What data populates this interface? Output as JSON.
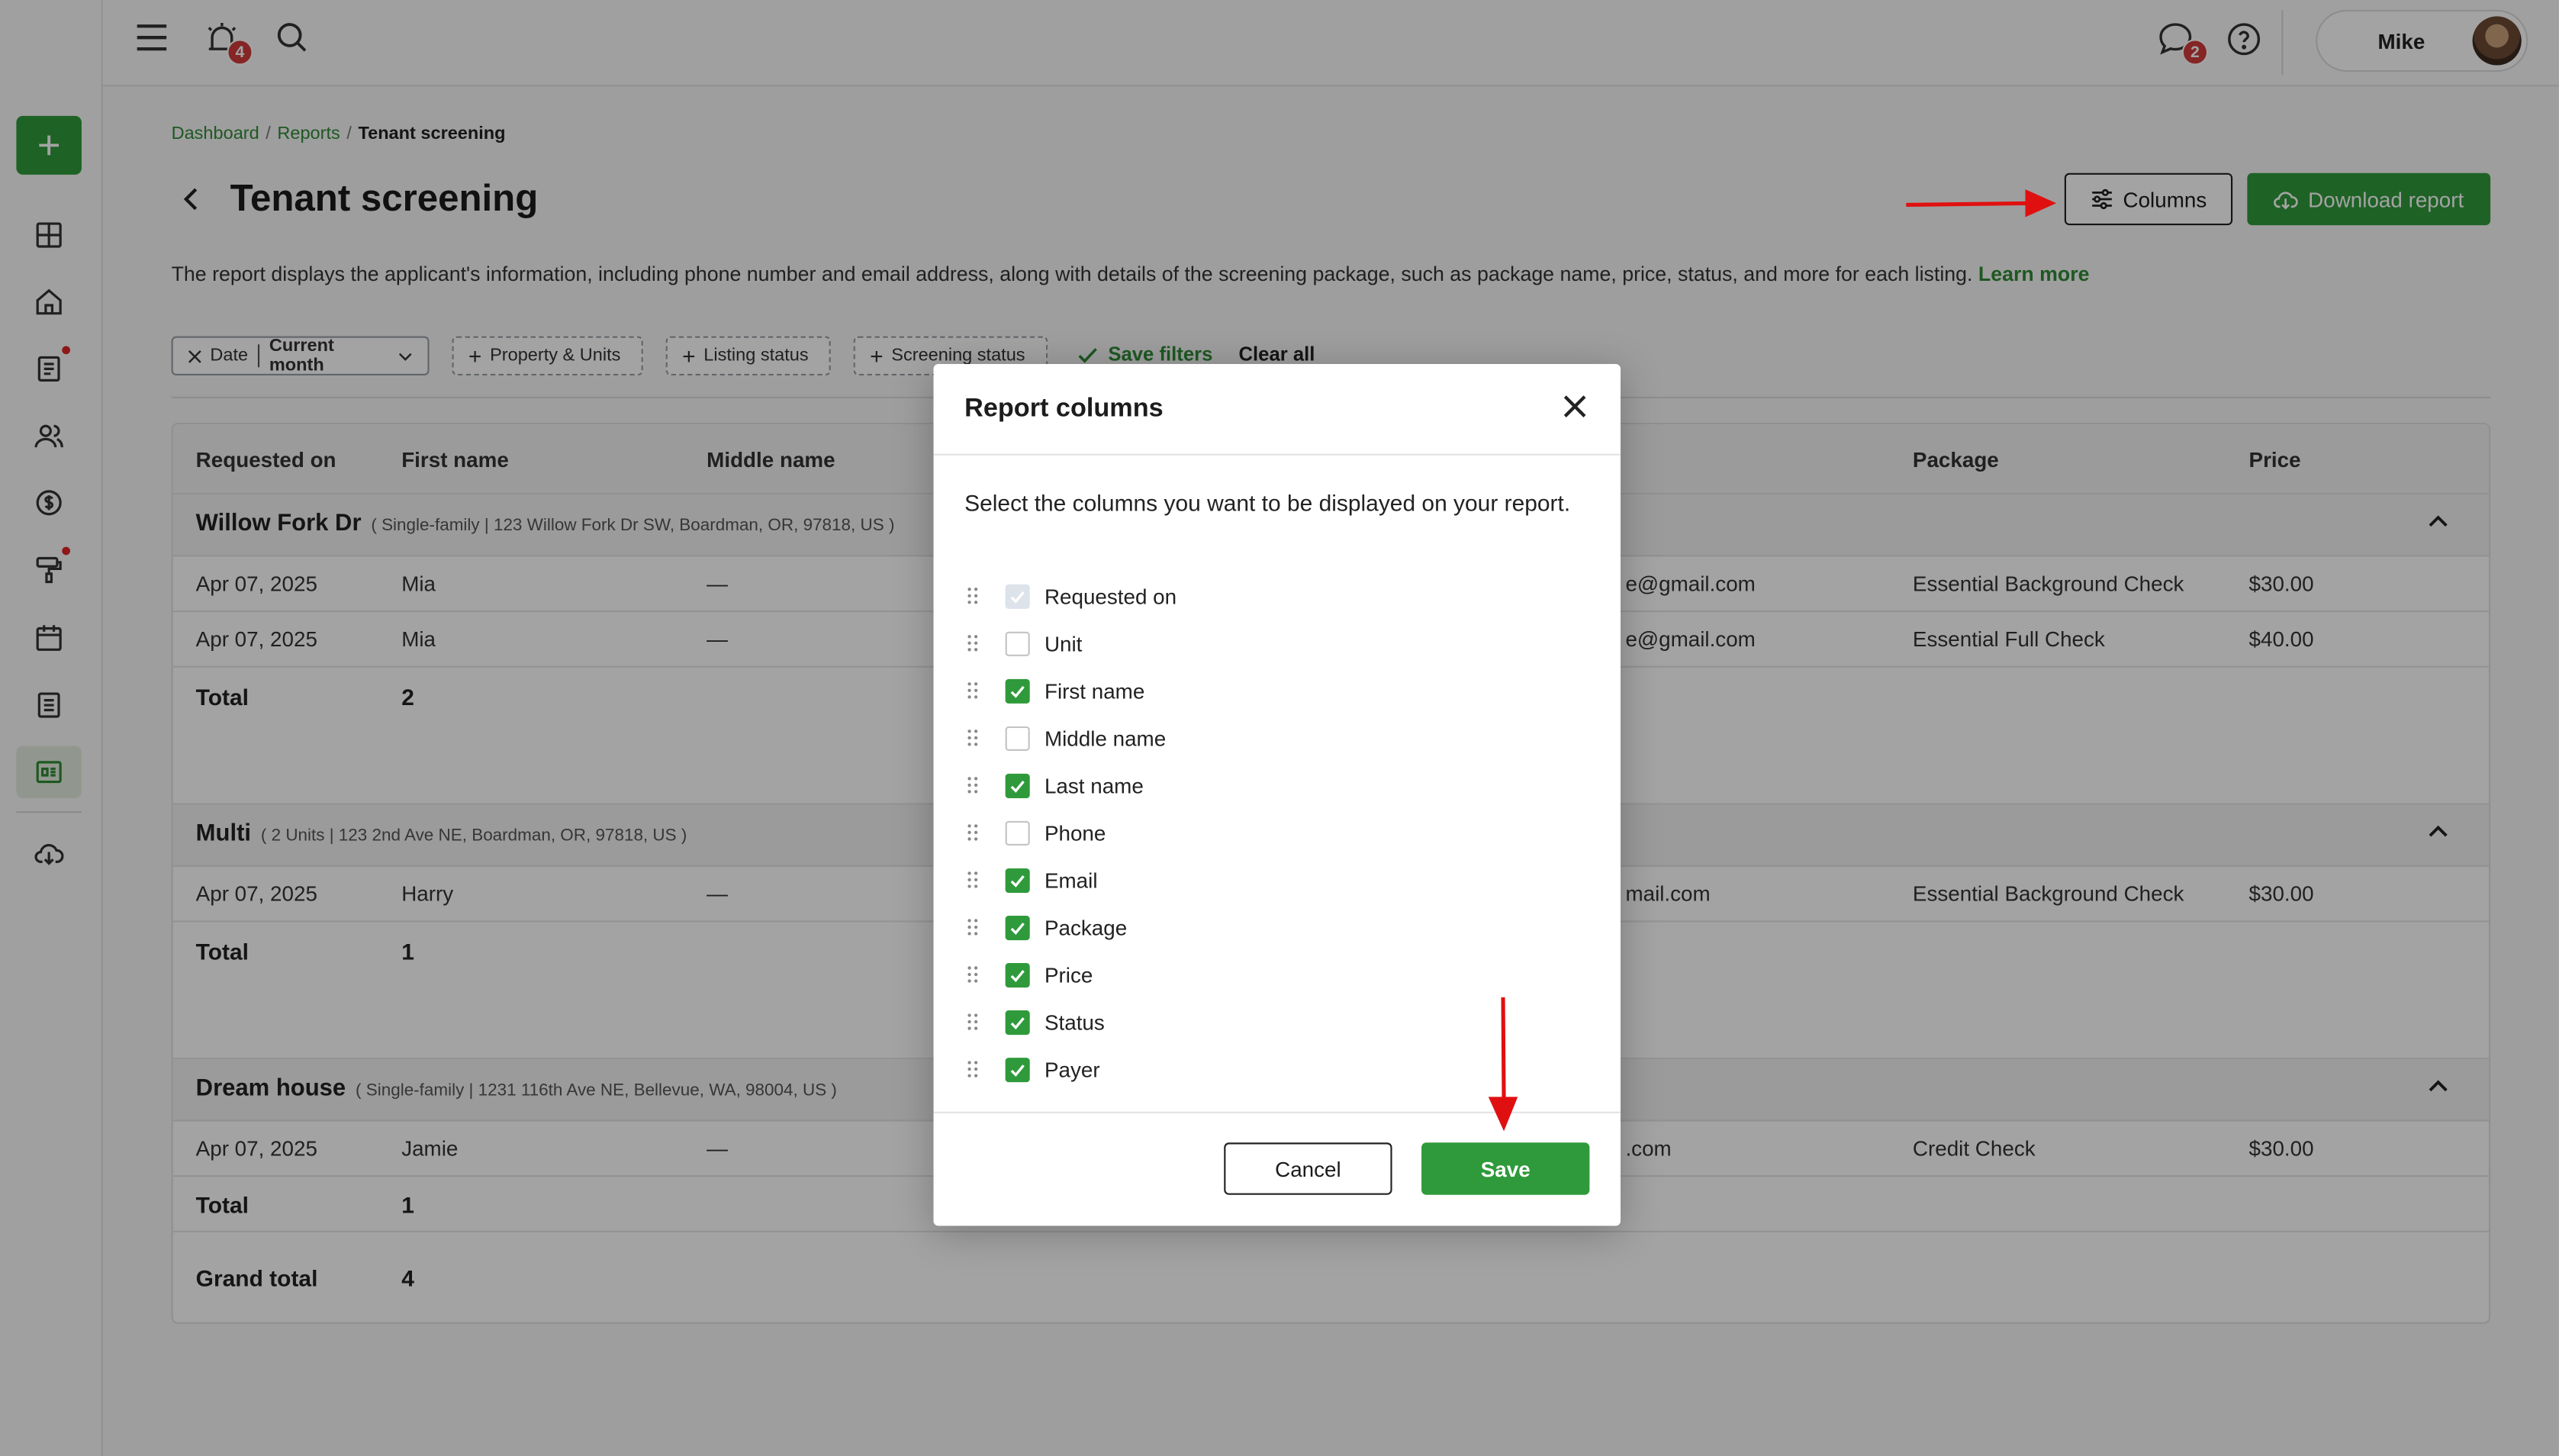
{
  "topbar": {
    "notifications_count": "4",
    "messages_count": "2",
    "user_name": "Mike"
  },
  "breadcrumb": {
    "items": [
      "Dashboard",
      "Reports"
    ],
    "current": "Tenant screening",
    "separator": "/"
  },
  "page": {
    "title": "Tenant screening",
    "columns_button": "Columns",
    "download_button": "Download report",
    "description": "The report displays the applicant's information, including phone number and email address, along with details of the screening package, such as package name, price, status, and more for each listing.",
    "learn_more": "Learn more"
  },
  "filters": {
    "date_label": "Date",
    "date_value": "Current month",
    "property_units": "Property & Units",
    "listing_status": "Listing status",
    "screening_status": "Screening status",
    "save_filters": "Save filters",
    "clear_all": "Clear all"
  },
  "table": {
    "headers": {
      "requested_on": "Requested on",
      "first_name": "First name",
      "middle_name": "Middle name",
      "package": "Package",
      "price": "Price"
    },
    "groups": [
      {
        "name": "Willow Fork Dr",
        "details": "( Single-family | 123 Willow Fork Dr SW, Boardman, OR, 97818, US )",
        "rows": [
          {
            "requested_on": "Apr 07, 2025",
            "first_name": "Mia",
            "middle_name": "—",
            "email": "e@gmail.com",
            "package": "Essential Background Check",
            "price": "$30.00"
          },
          {
            "requested_on": "Apr 07, 2025",
            "first_name": "Mia",
            "middle_name": "—",
            "email": "e@gmail.com",
            "package": "Essential Full Check",
            "price": "$40.00"
          }
        ],
        "total_label": "Total",
        "total": "2"
      },
      {
        "name": "Multi",
        "details": "( 2 Units | 123 2nd Ave NE, Boardman, OR, 97818, US )",
        "rows": [
          {
            "requested_on": "Apr 07, 2025",
            "first_name": "Harry",
            "middle_name": "—",
            "email": "mail.com",
            "package": "Essential Background Check",
            "price": "$30.00"
          }
        ],
        "total_label": "Total",
        "total": "1"
      },
      {
        "name": "Dream house",
        "details": "( Single-family | 1231 116th Ave NE, Bellevue, WA, 98004, US )",
        "rows": [
          {
            "requested_on": "Apr 07, 2025",
            "first_name": "Jamie",
            "middle_name": "—",
            "email": ".com",
            "package": "Credit Check",
            "price": "$30.00"
          }
        ],
        "total_label": "Total",
        "total": "1"
      }
    ],
    "grand_total_label": "Grand total",
    "grand_total": "4"
  },
  "modal": {
    "title": "Report columns",
    "description": "Select the columns you want to be displayed on your report.",
    "columns": [
      {
        "label": "Requested on",
        "state": "disabled"
      },
      {
        "label": "Unit",
        "state": "off"
      },
      {
        "label": "First name",
        "state": "on"
      },
      {
        "label": "Middle name",
        "state": "off"
      },
      {
        "label": "Last name",
        "state": "on"
      },
      {
        "label": "Phone",
        "state": "off"
      },
      {
        "label": "Email",
        "state": "on"
      },
      {
        "label": "Package",
        "state": "on"
      },
      {
        "label": "Price",
        "state": "on"
      },
      {
        "label": "Status",
        "state": "on"
      },
      {
        "label": "Payer",
        "state": "on"
      }
    ],
    "cancel": "Cancel",
    "save": "Save"
  },
  "colors": {
    "brand_green": "#2f9a3b",
    "link_green": "#2f8a36",
    "badge_red": "#d13b3b",
    "annotation_arrow": "#e01010"
  }
}
